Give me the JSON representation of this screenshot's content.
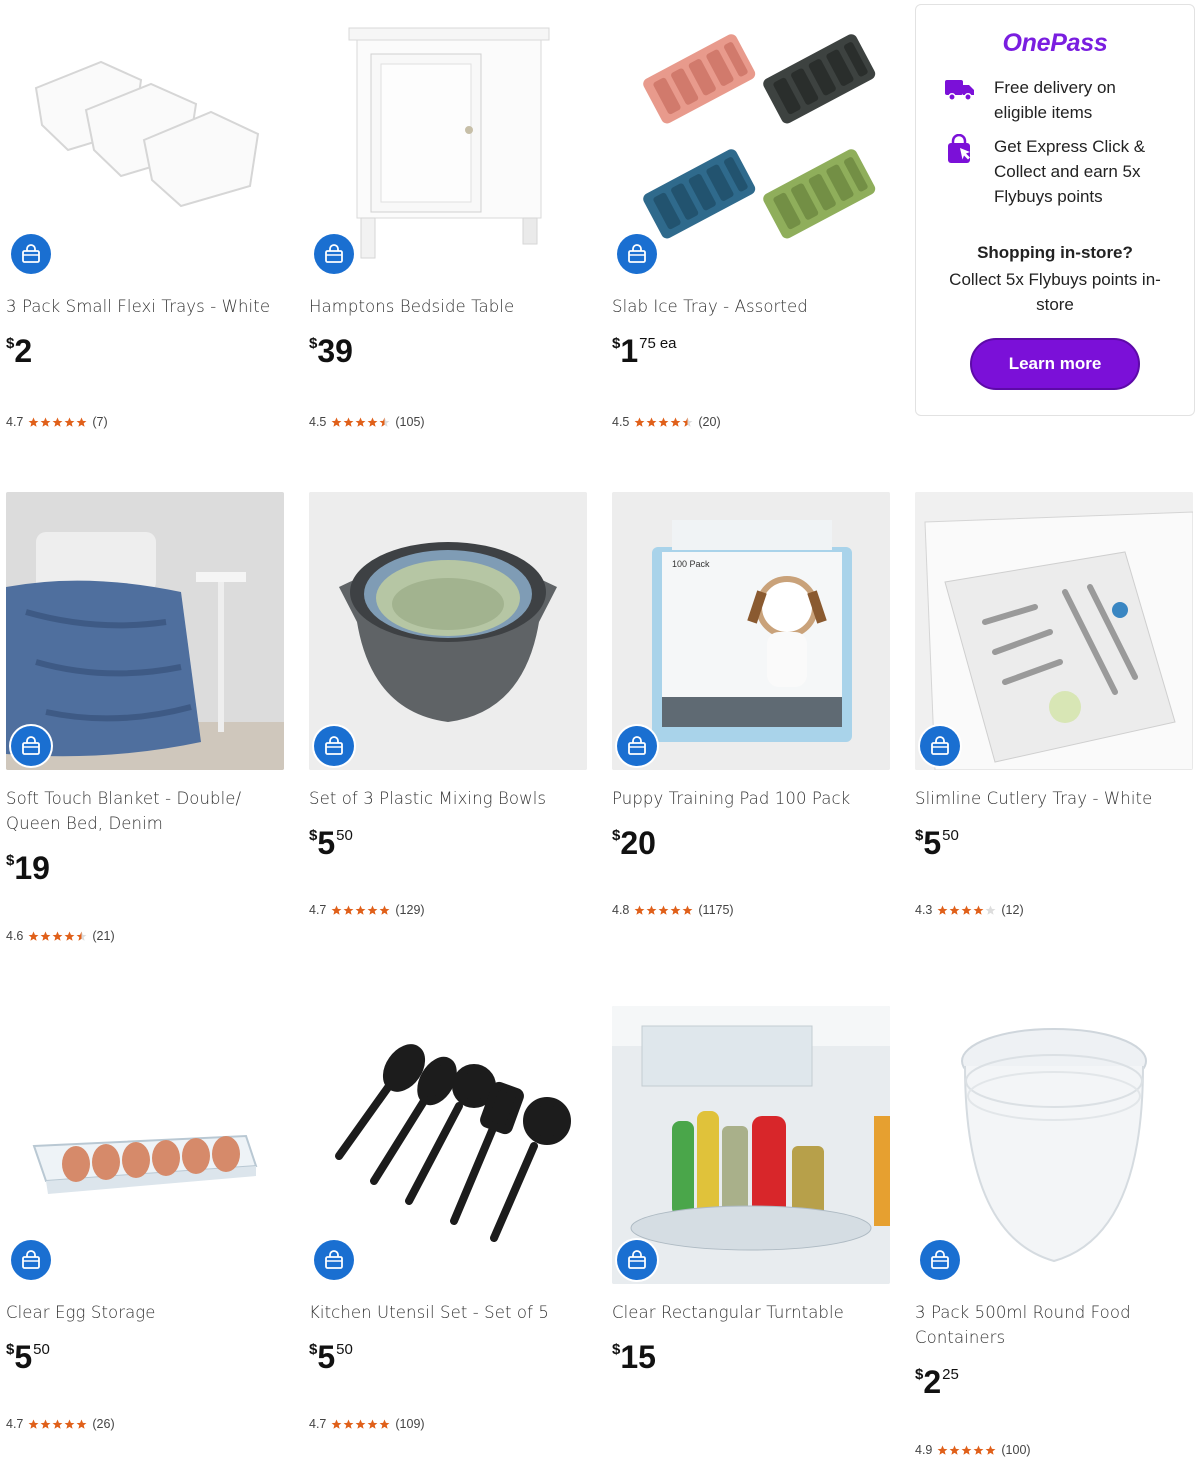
{
  "colors": {
    "accent": "#1a6fd1",
    "star": "#e0601a",
    "onepass": "#7b10d8"
  },
  "products": [
    {
      "name": "3 Pack Small Flexi Trays - White",
      "price_dollars": "2",
      "price_cents": "",
      "price_suffix": "",
      "rating": "4.7",
      "stars": 5,
      "reviews": "(7)",
      "icon": "bag-icon"
    },
    {
      "name": "Hamptons Bedside Table",
      "price_dollars": "39",
      "price_cents": "",
      "price_suffix": "",
      "rating": "4.5",
      "stars": 4.5,
      "reviews": "(105)",
      "icon": "bag-icon"
    },
    {
      "name": "Slab Ice Tray - Assorted",
      "price_dollars": "1",
      "price_cents": "75",
      "price_suffix": "ea",
      "rating": "4.5",
      "stars": 4.5,
      "reviews": "(20)",
      "icon": "bag-icon"
    },
    {
      "name": "Soft Touch Blanket - Double/ Queen Bed, Denim",
      "price_dollars": "19",
      "price_cents": "",
      "price_suffix": "",
      "rating": "4.6",
      "stars": 4.5,
      "reviews": "(21)",
      "icon": "bag-icon"
    },
    {
      "name": "Set of 3 Plastic Mixing Bowls",
      "price_dollars": "5",
      "price_cents": "50",
      "price_suffix": "",
      "rating": "4.7",
      "stars": 5,
      "reviews": "(129)",
      "icon": "bag-icon"
    },
    {
      "name": "Puppy Training Pad 100 Pack",
      "price_dollars": "20",
      "price_cents": "",
      "price_suffix": "",
      "rating": "4.8",
      "stars": 5,
      "reviews": "(1175)",
      "icon": "bag-icon"
    },
    {
      "name": "Slimline Cutlery Tray - White",
      "price_dollars": "5",
      "price_cents": "50",
      "price_suffix": "",
      "rating": "4.3",
      "stars": 4,
      "reviews": "(12)",
      "icon": "bag-icon"
    },
    {
      "name": "Clear Egg Storage",
      "price_dollars": "5",
      "price_cents": "50",
      "price_suffix": "",
      "rating": "4.7",
      "stars": 5,
      "reviews": "(26)",
      "icon": "bag-icon"
    },
    {
      "name": "Kitchen Utensil Set - Set of 5",
      "price_dollars": "5",
      "price_cents": "50",
      "price_suffix": "",
      "rating": "4.7",
      "stars": 5,
      "reviews": "(109)",
      "icon": "bag-icon"
    },
    {
      "name": "Clear Rectangular Turntable",
      "price_dollars": "15",
      "price_cents": "",
      "price_suffix": "",
      "rating": "",
      "stars": 0,
      "reviews": "",
      "icon": "bag-icon"
    },
    {
      "name": "3 Pack 500ml Round Food Containers",
      "price_dollars": "2",
      "price_cents": "25",
      "price_suffix": "",
      "rating": "4.9",
      "stars": 5,
      "reviews": "(100)",
      "icon": "bag-icon"
    }
  ],
  "currency_symbol": "$",
  "onepass": {
    "logo": "OnePass",
    "benefit_1": "Free delivery on eligible items",
    "benefit_2": "Get Express Click & Collect and earn 5x Flybuys points",
    "instore_heading": "Shopping in-store?",
    "instore_text": "Collect 5x Flybuys points in-store",
    "button_label": "Learn more"
  }
}
